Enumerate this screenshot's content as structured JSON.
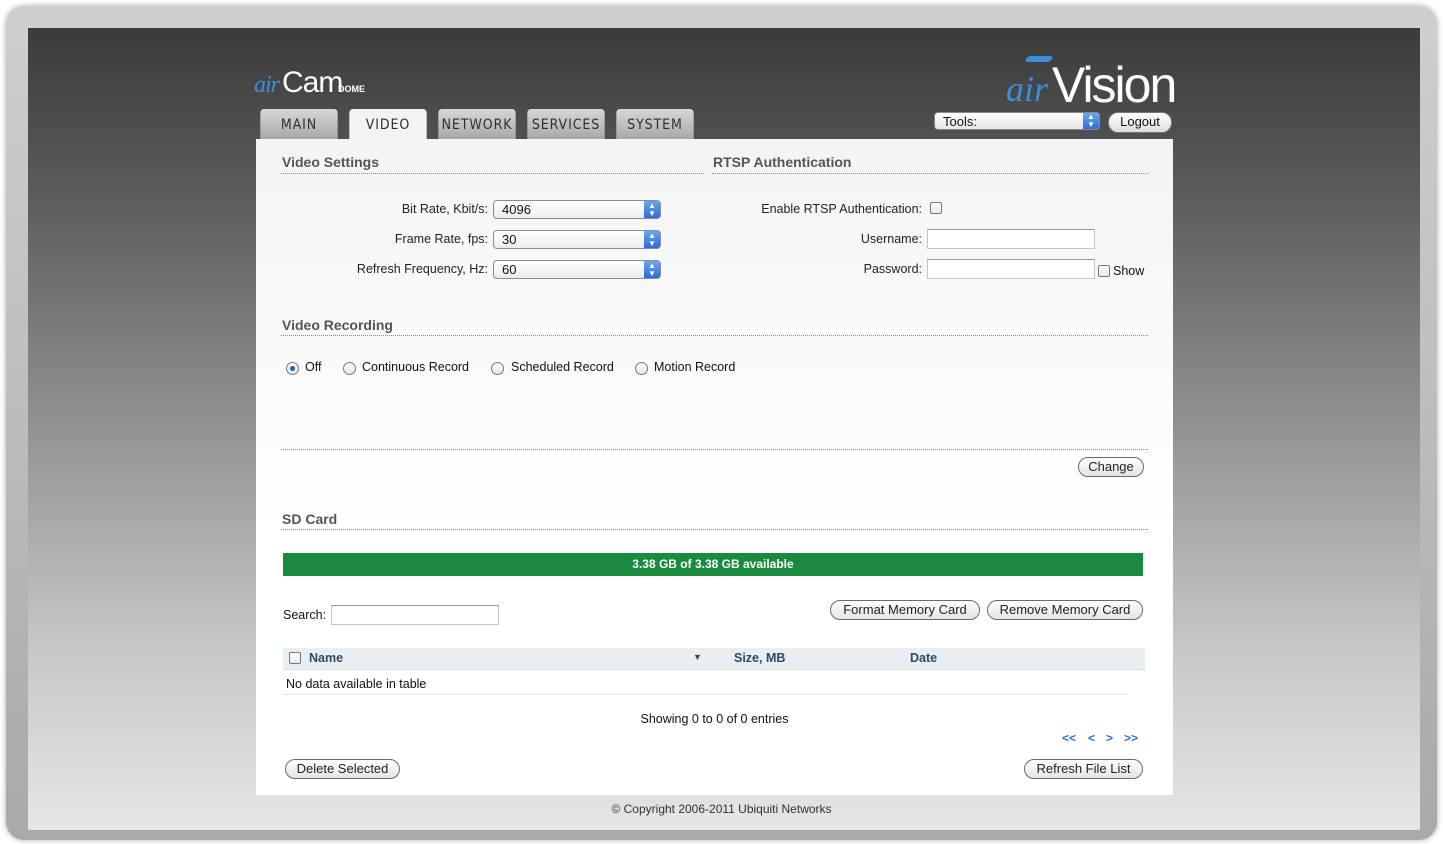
{
  "brand": {
    "product_prefix": "air",
    "product_name": "Cam",
    "product_suffix": "DOME",
    "suite_prefix": "air",
    "suite_name": "Vision",
    "accent_color": "#3a8fd8"
  },
  "tabs": [
    {
      "label": "MAIN",
      "active": false
    },
    {
      "label": "VIDEO",
      "active": true
    },
    {
      "label": "NETWORK",
      "active": false
    },
    {
      "label": "SERVICES",
      "active": false
    },
    {
      "label": "SYSTEM",
      "active": false
    }
  ],
  "header": {
    "tools_value": "Tools:",
    "logout_label": "Logout"
  },
  "video_settings": {
    "title": "Video Settings",
    "bit_rate_label": "Bit Rate, Kbit/s:",
    "bit_rate_value": "4096",
    "frame_rate_label": "Frame Rate, fps:",
    "frame_rate_value": "30",
    "refresh_label": "Refresh Frequency, Hz:",
    "refresh_value": "60"
  },
  "rtsp": {
    "title": "RTSP Authentication",
    "enable_label": "Enable RTSP Authentication:",
    "enable_checked": false,
    "username_label": "Username:",
    "username_value": "",
    "password_label": "Password:",
    "password_value": "",
    "show_label": "Show"
  },
  "video_recording": {
    "title": "Video Recording",
    "options": [
      {
        "label": "Off",
        "selected": true
      },
      {
        "label": "Continuous Record",
        "selected": false
      },
      {
        "label": "Scheduled Record",
        "selected": false
      },
      {
        "label": "Motion Record",
        "selected": false
      }
    ],
    "change_label": "Change"
  },
  "sd_card": {
    "title": "SD Card",
    "availability_text": "3.38 GB of 3.38 GB available",
    "availability_fraction": 1.0,
    "bar_color": "#1a8a3e",
    "search_label": "Search:",
    "search_value": "",
    "format_label": "Format Memory Card",
    "remove_label": "Remove Memory Card",
    "table": {
      "columns": [
        "Name",
        "Size, MB",
        "Date"
      ],
      "empty_text": "No data available in table"
    },
    "showing_text": "Showing 0 to 0 of 0 entries",
    "pager": {
      "first": "<<",
      "prev": "<",
      "next": ">",
      "last": ">>"
    },
    "delete_label": "Delete Selected",
    "refresh_label": "Refresh File List"
  },
  "footer": {
    "copyright": "© Copyright 2006-2011 Ubiquiti Networks"
  }
}
